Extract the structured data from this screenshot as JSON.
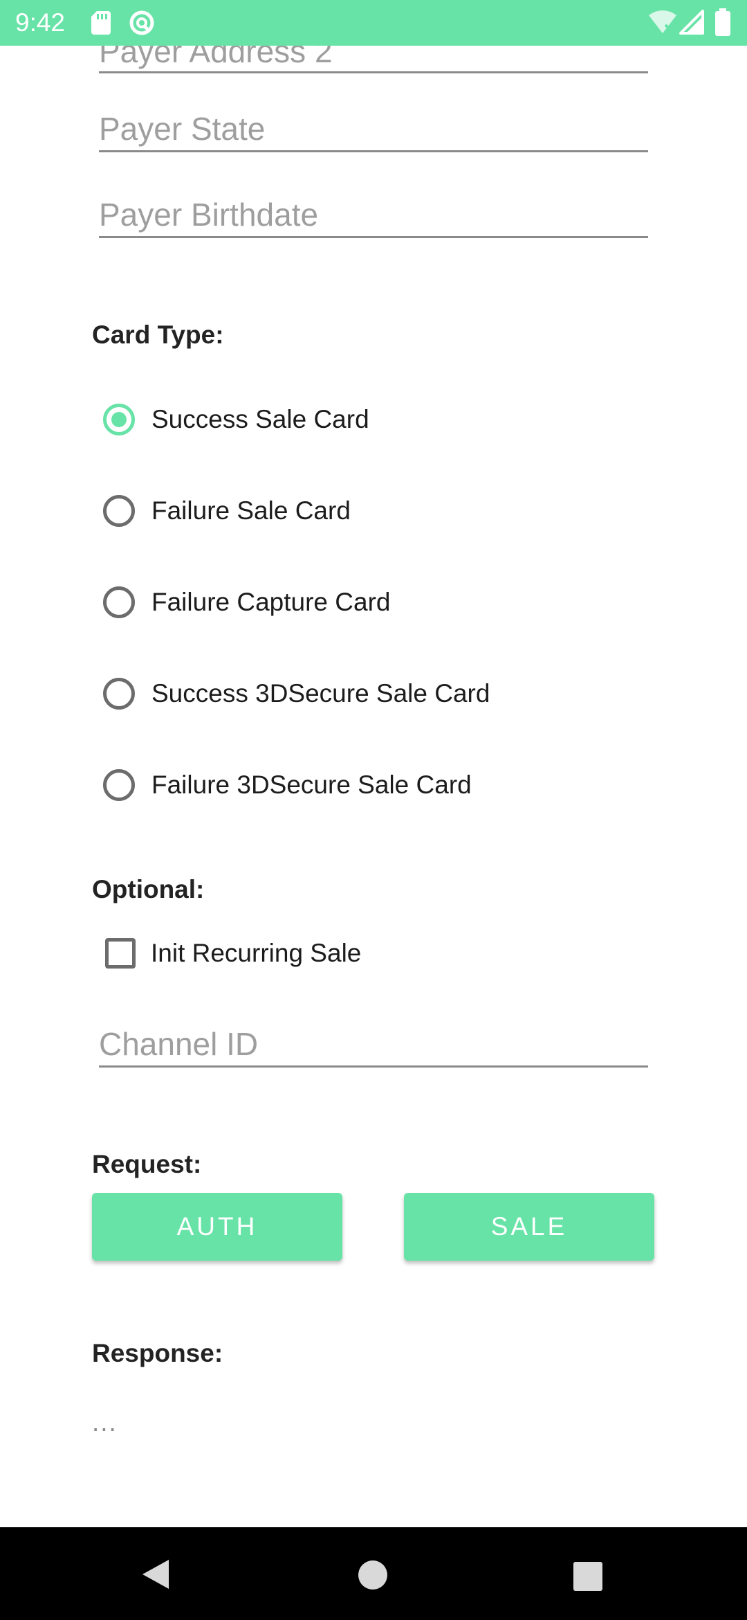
{
  "status_bar": {
    "time": "9:42",
    "background": "#68e3a7",
    "icons": [
      "sd-card-icon",
      "vpn-icon",
      "wifi-icon",
      "signal-icon",
      "battery-icon"
    ]
  },
  "form": {
    "payer_address2_placeholder": "Payer Address 2",
    "payer_state_placeholder": "Payer State",
    "payer_birthdate_placeholder": "Payer Birthdate",
    "card_type_label": "Card Type:",
    "card_types": [
      {
        "label": "Success Sale Card",
        "checked": true
      },
      {
        "label": "Failure Sale Card",
        "checked": false
      },
      {
        "label": "Failure Capture Card",
        "checked": false
      },
      {
        "label": "Success 3DSecure Sale Card",
        "checked": false
      },
      {
        "label": "Failure 3DSecure Sale Card",
        "checked": false
      }
    ],
    "optional_label": "Optional:",
    "init_recurring_label": "Init Recurring Sale",
    "init_recurring_checked": false,
    "channel_id_placeholder": "Channel ID",
    "request_label": "Request:",
    "auth_button": "AUTH",
    "sale_button": "SALE",
    "response_label": "Response:",
    "response_value": "..."
  },
  "colors": {
    "accent": "#68e3a7",
    "nav_bar": "#000000",
    "underline": "#8a8a8a"
  },
  "nav_bar": {
    "icons": [
      "back-icon",
      "home-icon",
      "recents-icon"
    ]
  }
}
